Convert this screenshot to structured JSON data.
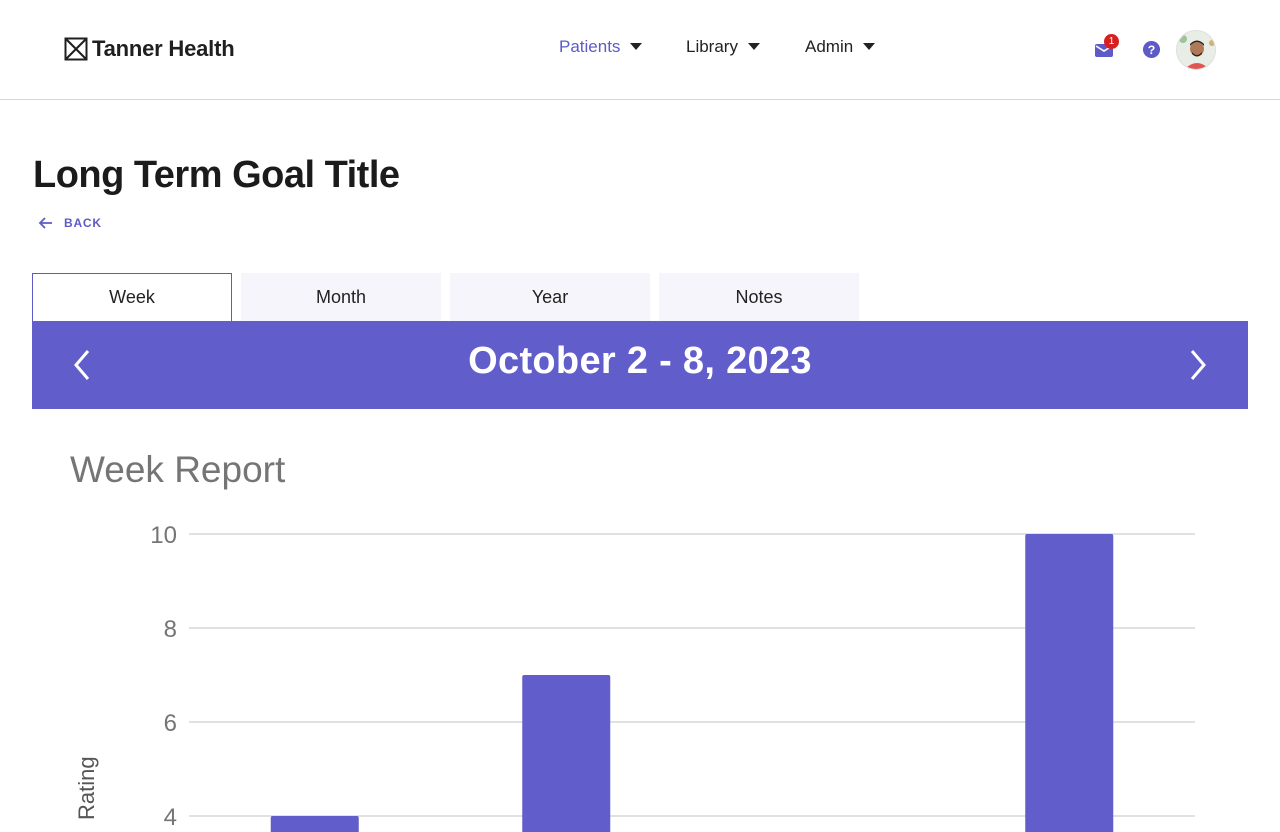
{
  "app": {
    "brand": "Tanner Health",
    "nav": [
      {
        "label": "Patients",
        "active": true
      },
      {
        "label": "Library",
        "active": false
      },
      {
        "label": "Admin",
        "active": false
      }
    ],
    "mail_badge": "1",
    "icons": {
      "mail": "mail-icon",
      "help": "help-icon",
      "avatar": "user-avatar"
    }
  },
  "page": {
    "title": "Long Term Goal Title",
    "back_label": "BACK"
  },
  "tabs": [
    {
      "label": "Week",
      "active": true
    },
    {
      "label": "Month",
      "active": false
    },
    {
      "label": "Year",
      "active": false
    },
    {
      "label": "Notes",
      "active": false
    }
  ],
  "period": {
    "label": "October 2 - 8, 2023"
  },
  "colors": {
    "accent": "#615dca",
    "nav_active": "#5d5bc7",
    "badge": "#d81e1e"
  },
  "chart_data": {
    "type": "bar",
    "title": "Week Report",
    "ylabel": "Rating",
    "ylim": [
      4,
      10
    ],
    "yticks": [
      10,
      8,
      6,
      4
    ],
    "grid": true,
    "values": [
      4,
      7,
      null,
      10
    ],
    "color": "#615dca"
  }
}
